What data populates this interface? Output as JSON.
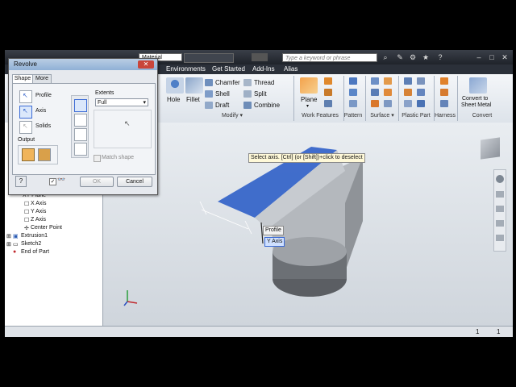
{
  "titlebar": {
    "material_label": "Material",
    "search_placeholder": "Type a keyword or phrase"
  },
  "tabs": [
    "Environments",
    "Get Started",
    "Add-Ins",
    "Alias"
  ],
  "ribbon": {
    "modify": {
      "hole": "Hole",
      "fillet": "Fillet",
      "chamfer": "Chamfer",
      "shell": "Shell",
      "draft": "Draft",
      "thread": "Thread",
      "split": "Split",
      "combine": "Combine",
      "group": "Modify"
    },
    "work_features": {
      "plane": "Plane",
      "group": "Work Features"
    },
    "pattern_group": "Pattern",
    "surface_group": "Surface",
    "plastic_part_group": "Plastic Part",
    "harness_group": "Harness",
    "convert": {
      "label_line1": "Convert to",
      "label_line2": "Sheet Metal",
      "group": "Convert"
    }
  },
  "dialog": {
    "title": "Revolve",
    "tab_shape": "Shape",
    "tab_more": "More",
    "profile": "Profile",
    "axis": "Axis",
    "solids": "Solids",
    "output": "Output",
    "extents": "Extents",
    "extents_value": "Full",
    "match_shape": "Match shape",
    "ok": "OK",
    "cancel": "Cancel"
  },
  "viewport": {
    "hint": "Select axis. [Ctrl] (or [Shift])+click to deselect",
    "profile_tag": "Profile",
    "axis_tag": "Y Axis"
  },
  "browser": {
    "items": [
      "XY Plane",
      "X Axis",
      "Y Axis",
      "Z Axis",
      "Center Point",
      "Extrusion1",
      "Sketch2",
      "End of Part"
    ]
  },
  "status": {
    "count1": "1",
    "count2": "1"
  },
  "colors": {
    "accent_blue": "#2f5fc8",
    "title_dark": "#1f232a"
  }
}
